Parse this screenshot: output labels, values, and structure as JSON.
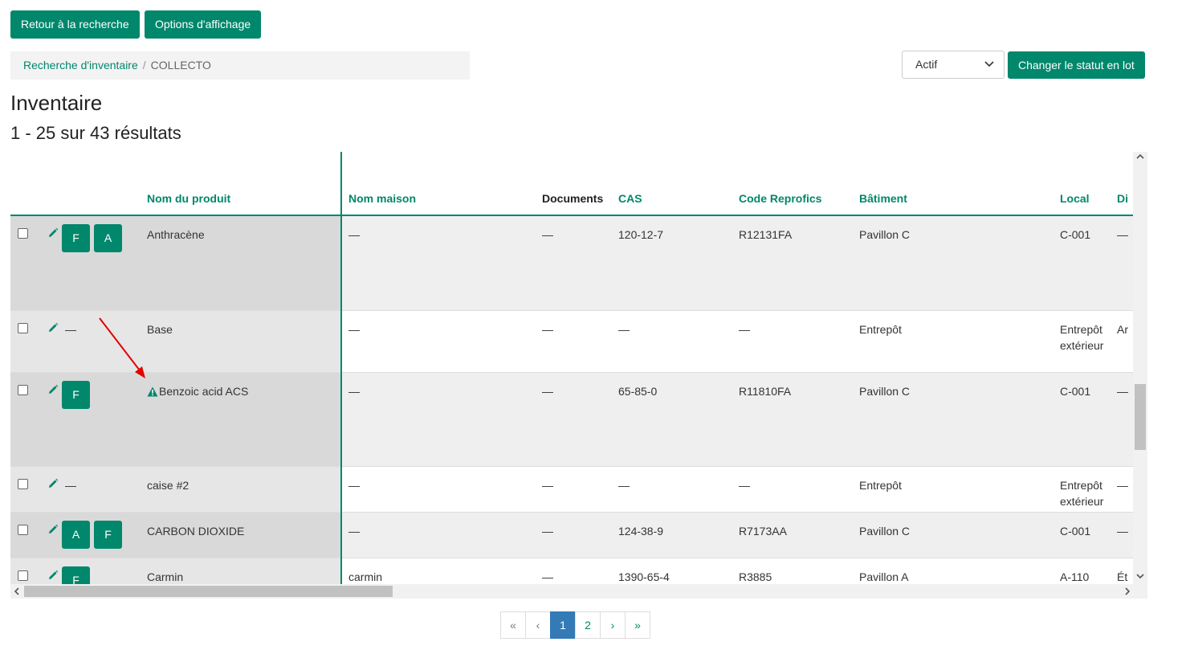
{
  "toolbar": {
    "back_label": "Retour à la recherche",
    "display_options_label": "Options d'affichage"
  },
  "breadcrumb": {
    "link": "Recherche d'inventaire",
    "separator": "/",
    "current": "COLLECTO"
  },
  "status_filter": {
    "value": "Actif",
    "batch_button": "Changer le statut en lot"
  },
  "page": {
    "title": "Inventaire",
    "results": "1 - 25 sur 43 résultats"
  },
  "table": {
    "columns": [
      "Nom du produit",
      "Nom maison",
      "Documents",
      "CAS",
      "Code Reprofics",
      "Bâtiment",
      "Local",
      "Di"
    ],
    "rows": [
      {
        "badges": [
          "F",
          "A"
        ],
        "badge_dash": "",
        "product": "Anthracène",
        "house": "—",
        "docs": "—",
        "cas": "120-12-7",
        "code": "R12131FA",
        "building": "Pavillon C",
        "local": "C-001",
        "extra": "—"
      },
      {
        "badges": [],
        "badge_dash": "—",
        "product": "Base",
        "house": "—",
        "docs": "—",
        "cas": "—",
        "code": "—",
        "building": "Entrepôt",
        "local": "Entrepôt extérieur",
        "extra": "Ar"
      },
      {
        "badges": [
          "F"
        ],
        "badge_dash": "",
        "product": "Benzoic acid ACS",
        "house": "—",
        "docs": "—",
        "cas": "65-85-0",
        "code": "R11810FA",
        "building": "Pavillon C",
        "local": "C-001",
        "extra": "—"
      },
      {
        "badges": [],
        "badge_dash": "—",
        "product": "caise #2",
        "house": "—",
        "docs": "—",
        "cas": "—",
        "code": "—",
        "building": "Entrepôt",
        "local": "Entrepôt extérieur",
        "extra": "—"
      },
      {
        "badges": [
          "A",
          "F"
        ],
        "badge_dash": "",
        "product": "CARBON DIOXIDE",
        "house": "—",
        "docs": "—",
        "cas": "124-38-9",
        "code": "R7173AA",
        "building": "Pavillon C",
        "local": "C-001",
        "extra": "—"
      },
      {
        "badges": [
          "F"
        ],
        "badge_dash": "",
        "product": "Carmin",
        "house": "carmin",
        "docs": "—",
        "cas": "1390-65-4",
        "code": "R3885",
        "building": "Pavillon A",
        "local": "A-110",
        "extra": "Ét"
      }
    ]
  },
  "pagination": {
    "first": "«",
    "prev": "‹",
    "pages": [
      "1",
      "2"
    ],
    "current": "1",
    "next": "›",
    "last": "»"
  },
  "colors": {
    "accent": "#00876c",
    "active_page": "#337ab7",
    "warning_arrow": "#e00000"
  }
}
